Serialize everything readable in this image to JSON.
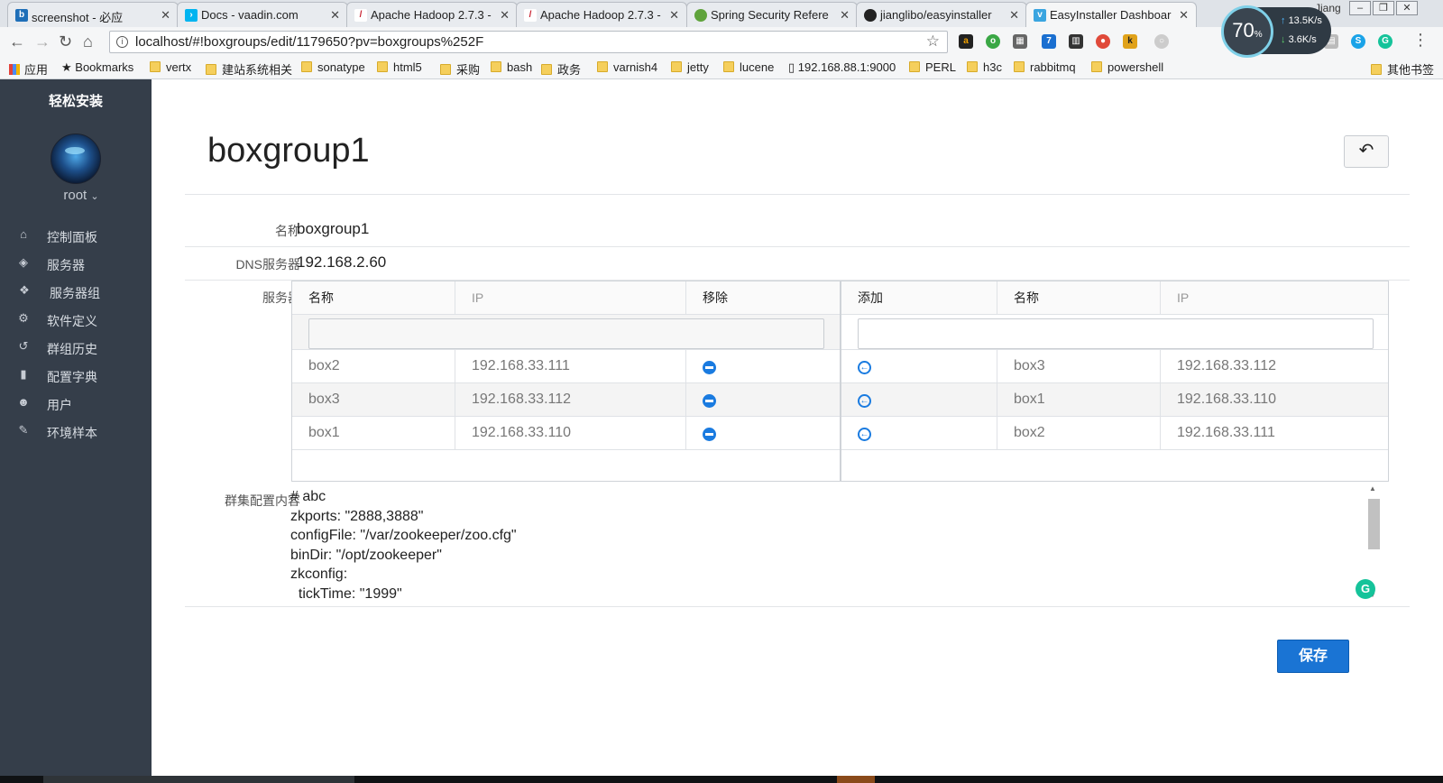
{
  "browser": {
    "tabs": [
      {
        "title": "screenshot - 必应",
        "icon": "bing-icon",
        "color": "#1f6fb8",
        "glyph": "b"
      },
      {
        "title": "Docs - vaadin.com",
        "icon": "vaadin-icon",
        "color": "#00b4f0",
        "glyph": "›"
      },
      {
        "title": "Apache Hadoop 2.7.3 -",
        "icon": "hadoop-feather-icon",
        "color": "#c8202f",
        "glyph": "/"
      },
      {
        "title": "Apache Hadoop 2.7.3 -",
        "icon": "hadoop-feather-icon",
        "color": "#c8202f",
        "glyph": "/"
      },
      {
        "title": "Spring Security Refere",
        "icon": "spring-leaf-icon",
        "color": "#5fa33c",
        "glyph": "●"
      },
      {
        "title": "jianglibo/easyinstaller",
        "icon": "github-icon",
        "color": "#222222",
        "glyph": "●"
      },
      {
        "title": "EasyInstaller Dashboar",
        "icon": "vaadin-v-icon",
        "color": "#3aa5e0",
        "glyph": "v"
      }
    ],
    "profile_name": "Jiang",
    "url": "localhost/#!boxgroups/edit/1179650?pv=boxgroups%252F",
    "speed_widget": {
      "percent": "70",
      "percent_unit": "%",
      "up": "13.5K/s",
      "down": "3.6K/s"
    },
    "bookmarks": [
      {
        "label": "应用",
        "kind": "apps"
      },
      {
        "label": "Bookmarks",
        "kind": "star"
      },
      {
        "label": "vertx",
        "kind": "folder"
      },
      {
        "label": "建站系统相关",
        "kind": "folder"
      },
      {
        "label": "sonatype",
        "kind": "folder"
      },
      {
        "label": "html5",
        "kind": "folder"
      },
      {
        "label": "采购",
        "kind": "folder"
      },
      {
        "label": "bash",
        "kind": "folder"
      },
      {
        "label": "政务",
        "kind": "folder"
      },
      {
        "label": "varnish4",
        "kind": "folder"
      },
      {
        "label": "jetty",
        "kind": "folder"
      },
      {
        "label": "lucene",
        "kind": "folder"
      },
      {
        "label": "192.168.88.1:9000",
        "kind": "page"
      },
      {
        "label": "PERL",
        "kind": "folder"
      },
      {
        "label": "h3c",
        "kind": "folder"
      },
      {
        "label": "rabbitmq",
        "kind": "folder"
      },
      {
        "label": "powershell",
        "kind": "folder"
      },
      {
        "label": "其他书签",
        "kind": "folder"
      }
    ]
  },
  "sidebar": {
    "brand": "轻松安装",
    "user": "root",
    "items": [
      {
        "label": "控制面板",
        "icon": "home-icon"
      },
      {
        "label": "服务器",
        "icon": "cube-icon"
      },
      {
        "label": "服务器组",
        "icon": "cubes-icon"
      },
      {
        "label": "软件定义",
        "icon": "cogs-icon"
      },
      {
        "label": "群组历史",
        "icon": "history-icon"
      },
      {
        "label": "配置字典",
        "icon": "book-icon"
      },
      {
        "label": "用户",
        "icon": "users-icon"
      },
      {
        "label": "环境样本",
        "icon": "wrench-icon"
      }
    ]
  },
  "page": {
    "title": "boxgroup1",
    "fields": {
      "name_label": "名称",
      "name_value": "boxgroup1",
      "dns_label": "DNS服务器",
      "dns_value": "192.168.2.60",
      "servers_label": "服务器",
      "config_label": "群集配置内容"
    },
    "selected_table": {
      "headers": [
        "名称",
        "IP",
        "移除"
      ],
      "filter_placeholder": "",
      "rows": [
        {
          "name": "box2",
          "ip": "192.168.33.111"
        },
        {
          "name": "box3",
          "ip": "192.168.33.112"
        },
        {
          "name": "box1",
          "ip": "192.168.33.110"
        }
      ]
    },
    "available_table": {
      "headers": [
        "添加",
        "名称",
        "IP"
      ],
      "filter_placeholder": "",
      "rows": [
        {
          "name": "box3",
          "ip": "192.168.33.112"
        },
        {
          "name": "box1",
          "ip": "192.168.33.110"
        },
        {
          "name": "box2",
          "ip": "192.168.33.111"
        }
      ]
    },
    "config_text": "# abc\nzkports: \"2888,3888\"\nconfigFile: \"/var/zookeeper/zoo.cfg\"\nbinDir: \"/opt/zookeeper\"\nzkconfig:\n  tickTime: \"1999\"",
    "save_label": "保存"
  },
  "colors": {
    "sidebar_bg": "#353e4a",
    "accent_blue": "#1a74d4"
  }
}
